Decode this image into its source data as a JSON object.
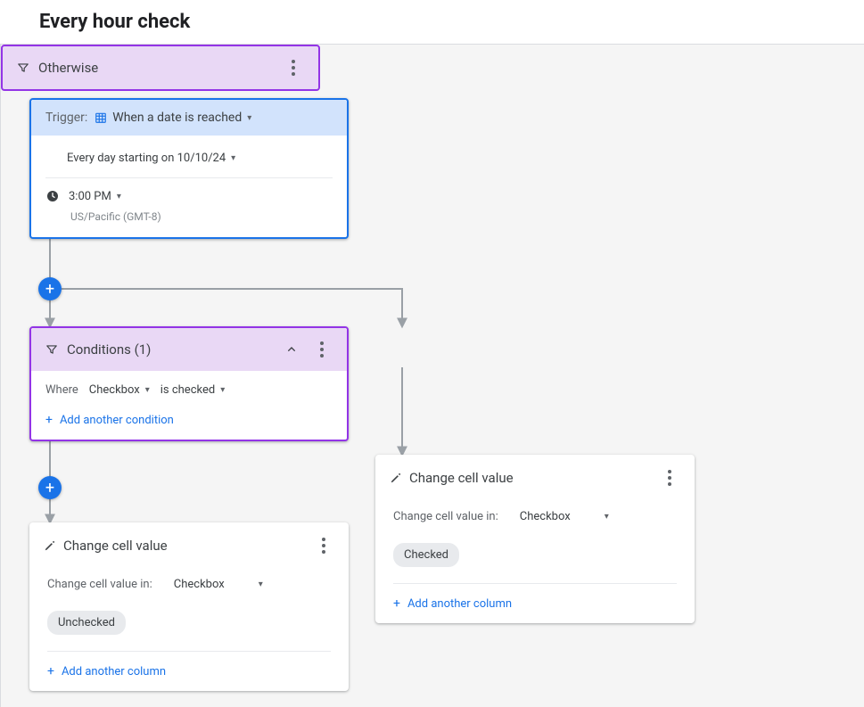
{
  "page_title": "Every hour check",
  "trigger": {
    "prefix": "Trigger:",
    "type": "When a date is reached",
    "recurrence": "Every day starting on 10/10/24",
    "time": "3:00 PM",
    "timezone": "US/Pacific (GMT-8)"
  },
  "conditions": {
    "title": "Conditions (1)",
    "where_label": "Where",
    "field": "Checkbox",
    "operator": "is checked",
    "add_label": "Add another condition"
  },
  "otherwise": {
    "title": "Otherwise"
  },
  "action1": {
    "title": "Change cell value",
    "label": "Change cell value in:",
    "field": "Checkbox",
    "value": "Unchecked",
    "add_label": "Add another column"
  },
  "action2": {
    "title": "Change cell value",
    "label": "Change cell value in:",
    "field": "Checkbox",
    "value": "Checked",
    "add_label": "Add another column"
  }
}
